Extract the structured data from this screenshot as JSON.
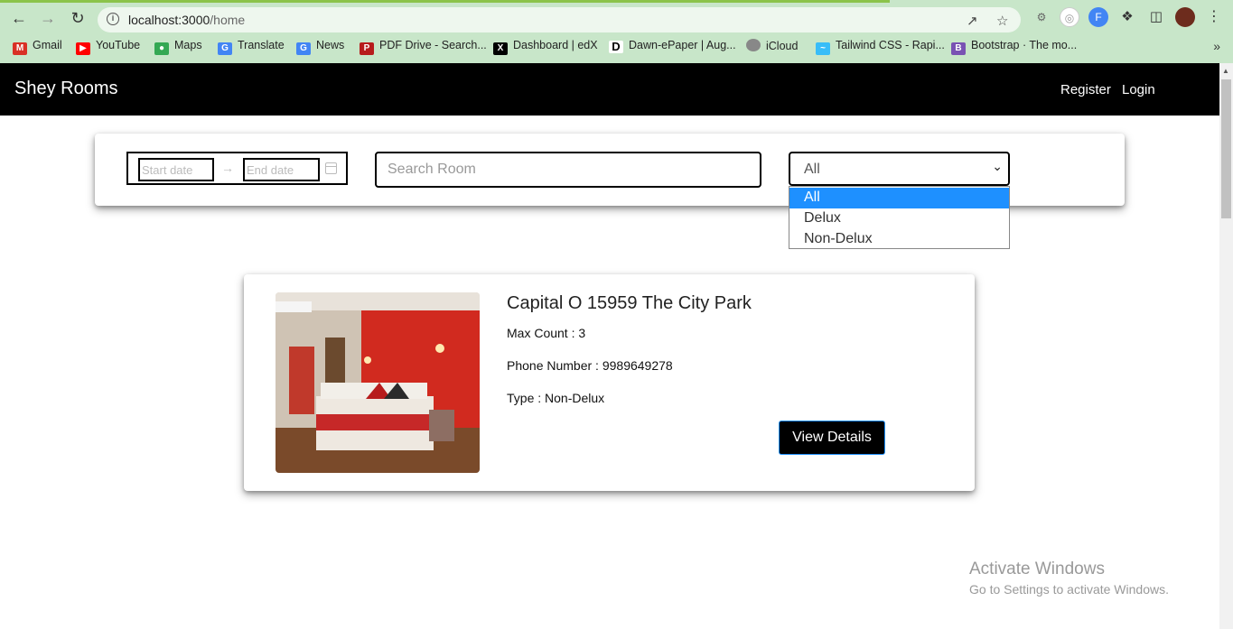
{
  "browser": {
    "url_host": "localhost:3000",
    "url_path": "/home",
    "bookmarks": [
      {
        "label": "Gmail",
        "icon": "gmail-icon",
        "color": "#d93025"
      },
      {
        "label": "YouTube",
        "icon": "youtube-icon",
        "color": "#ff0000"
      },
      {
        "label": "Maps",
        "icon": "maps-icon",
        "color": "#34a853"
      },
      {
        "label": "Translate",
        "icon": "translate-icon",
        "color": "#4285f4"
      },
      {
        "label": "News",
        "icon": "news-icon",
        "color": "#4285f4"
      },
      {
        "label": "PDF Drive - Search...",
        "icon": "pdfdrive-icon",
        "color": "#b71c1c"
      },
      {
        "label": "Dashboard | edX",
        "icon": "edx-icon",
        "color": "#000000"
      },
      {
        "label": "Dawn-ePaper | Aug...",
        "icon": "dawn-icon",
        "color": "#000000"
      },
      {
        "label": "iCloud",
        "icon": "apple-icon",
        "color": "#888888"
      },
      {
        "label": "Tailwind CSS - Rapi...",
        "icon": "tailwind-icon",
        "color": "#38bdf8"
      },
      {
        "label": "Bootstrap · The mo...",
        "icon": "bootstrap-icon",
        "color": "#7952b3"
      }
    ]
  },
  "navbar": {
    "brand": "Shey Rooms",
    "links": [
      "Register",
      "Login"
    ]
  },
  "filters": {
    "start_placeholder": "Start date",
    "end_placeholder": "End date",
    "search_placeholder": "Search Room",
    "type_selected": "All",
    "type_options": [
      "All",
      "Delux",
      "Non-Delux"
    ]
  },
  "rooms": [
    {
      "name": "Capital O 15959 The City Park",
      "max_count": "Max Count : 3",
      "phone": "Phone Number : 9989649278",
      "type": "Type : Non-Delux",
      "button": "View Details"
    }
  ],
  "watermark": {
    "title": "Activate Windows",
    "subtitle": "Go to Settings to activate Windows."
  },
  "colors": {
    "accent": "#1e90ff",
    "navbar": "#000000",
    "chrome": "#c8e6c9"
  }
}
